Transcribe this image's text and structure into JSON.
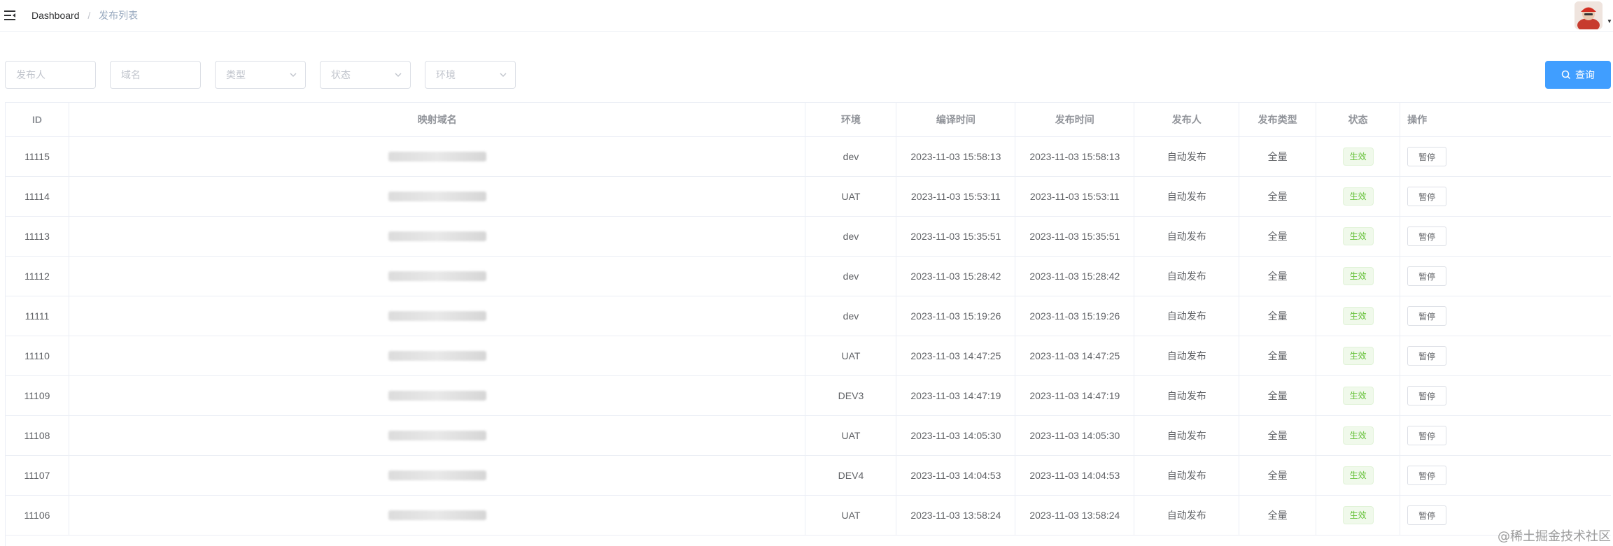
{
  "breadcrumb": {
    "home": "Dashboard",
    "separator": "/",
    "current": "发布列表"
  },
  "filters": {
    "publisher_placeholder": "发布人",
    "domain_placeholder": "域名",
    "type_placeholder": "类型",
    "status_placeholder": "状态",
    "env_placeholder": "环境",
    "query_label": "查询"
  },
  "table": {
    "headers": {
      "id": "ID",
      "domain": "映射域名",
      "env": "环境",
      "compile_time": "编译时间",
      "publish_time": "发布时间",
      "publisher": "发布人",
      "publish_type": "发布类型",
      "status": "状态",
      "ops": "操作"
    },
    "rows": [
      {
        "id": "11115",
        "env": "dev",
        "compile_time": "2023-11-03 15:58:13",
        "publish_time": "2023-11-03 15:58:13",
        "publisher": "自动发布",
        "publish_type": "全量",
        "status": "生效",
        "action": "暂停"
      },
      {
        "id": "11114",
        "env": "UAT",
        "compile_time": "2023-11-03 15:53:11",
        "publish_time": "2023-11-03 15:53:11",
        "publisher": "自动发布",
        "publish_type": "全量",
        "status": "生效",
        "action": "暂停"
      },
      {
        "id": "11113",
        "env": "dev",
        "compile_time": "2023-11-03 15:35:51",
        "publish_time": "2023-11-03 15:35:51",
        "publisher": "自动发布",
        "publish_type": "全量",
        "status": "生效",
        "action": "暂停"
      },
      {
        "id": "11112",
        "env": "dev",
        "compile_time": "2023-11-03 15:28:42",
        "publish_time": "2023-11-03 15:28:42",
        "publisher": "自动发布",
        "publish_type": "全量",
        "status": "生效",
        "action": "暂停"
      },
      {
        "id": "11111",
        "env": "dev",
        "compile_time": "2023-11-03 15:19:26",
        "publish_time": "2023-11-03 15:19:26",
        "publisher": "自动发布",
        "publish_type": "全量",
        "status": "生效",
        "action": "暂停"
      },
      {
        "id": "11110",
        "env": "UAT",
        "compile_time": "2023-11-03 14:47:25",
        "publish_time": "2023-11-03 14:47:25",
        "publisher": "自动发布",
        "publish_type": "全量",
        "status": "生效",
        "action": "暂停"
      },
      {
        "id": "11109",
        "env": "DEV3",
        "compile_time": "2023-11-03 14:47:19",
        "publish_time": "2023-11-03 14:47:19",
        "publisher": "自动发布",
        "publish_type": "全量",
        "status": "生效",
        "action": "暂停"
      },
      {
        "id": "11108",
        "env": "UAT",
        "compile_time": "2023-11-03 14:05:30",
        "publish_time": "2023-11-03 14:05:30",
        "publisher": "自动发布",
        "publish_type": "全量",
        "status": "生效",
        "action": "暂停"
      },
      {
        "id": "11107",
        "env": "DEV4",
        "compile_time": "2023-11-03 14:04:53",
        "publish_time": "2023-11-03 14:04:53",
        "publisher": "自动发布",
        "publish_type": "全量",
        "status": "生效",
        "action": "暂停"
      },
      {
        "id": "11106",
        "env": "UAT",
        "compile_time": "2023-11-03 13:58:24",
        "publish_time": "2023-11-03 13:58:24",
        "publisher": "自动发布",
        "publish_type": "全量",
        "status": "生效",
        "action": "暂停"
      }
    ]
  },
  "watermark": "@稀土掘金技术社区",
  "colors": {
    "primary": "#409eff",
    "success": "#67c23a",
    "border": "#ebeef5"
  },
  "icons": {
    "menu": "hamburger-icon",
    "search": "search-icon",
    "dropdown": "chevron-down-icon",
    "avatar": "avatar"
  }
}
